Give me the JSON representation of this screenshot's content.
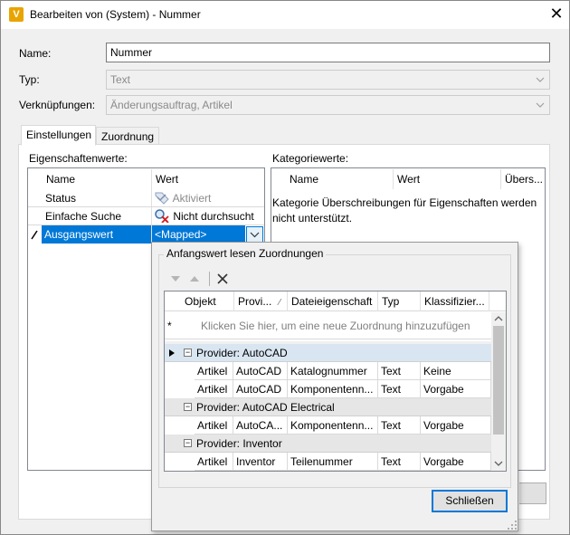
{
  "window": {
    "title": "Bearbeiten von (System) - Nummer",
    "app_icon_letter": "V"
  },
  "form": {
    "name_label": "Name:",
    "name_value": "Nummer",
    "type_label": "Typ:",
    "type_value": "Text",
    "links_label": "Verknüpfungen:",
    "links_value": "Änderungsauftrag, Artikel"
  },
  "tabs": [
    {
      "label": "Einstellungen"
    },
    {
      "label": "Zuordnung"
    }
  ],
  "properties": {
    "label": "Eigenschaftenwerte:",
    "columns": {
      "name": "Name",
      "value": "Wert"
    },
    "rows": [
      {
        "name": "Status",
        "value": "Aktiviert"
      },
      {
        "name": "Einfache Suche",
        "value": "Nicht durchsucht"
      },
      {
        "name": "Ausgangswert",
        "value": "<Mapped>"
      }
    ]
  },
  "categories": {
    "label": "Kategoriewerte:",
    "columns": {
      "name": "Name",
      "value": "Wert",
      "override": "Übers..."
    },
    "message": "Kategorie Überschreibungen für Eigenschaften werden nicht unterstützt."
  },
  "mapping": {
    "group_title": "Anfangswert lesen Zuordnungen",
    "columns": {
      "object": "Objekt",
      "provider": "Provi...",
      "file_property": "Dateieigenschaft",
      "type": "Typ",
      "classification": "Klassifizier..."
    },
    "new_row_hint": "Klicken Sie hier, um eine neue Zuordnung hinzuzufügen",
    "groups": [
      {
        "title": "Provider: AutoCAD",
        "rows": [
          {
            "object": "Artikel",
            "provider": "AutoCAD",
            "file_property": "Katalognummer",
            "type": "Text",
            "classification": "Keine"
          },
          {
            "object": "Artikel",
            "provider": "AutoCAD",
            "file_property": "Komponentenn...",
            "type": "Text",
            "classification": "Vorgabe"
          }
        ]
      },
      {
        "title": "Provider: AutoCAD Electrical",
        "rows": [
          {
            "object": "Artikel",
            "provider": "AutoCA...",
            "file_property": "Komponentenn...",
            "type": "Text",
            "classification": "Vorgabe"
          }
        ]
      },
      {
        "title": "Provider: Inventor",
        "rows": [
          {
            "object": "Artikel",
            "provider": "Inventor",
            "file_property": "Teilenummer",
            "type": "Text",
            "classification": "Vorgabe"
          }
        ]
      }
    ],
    "close_label": "Schließen"
  },
  "colors": {
    "selection": "#0078d7",
    "accent_icon": "#e8a400"
  },
  "icons": [
    "app-icon",
    "close-icon",
    "checkmark-tag-icon",
    "no-search-icon",
    "pencil-icon",
    "dropdown-arrow-icon",
    "move-down-icon",
    "move-up-icon",
    "delete-icon",
    "asterisk-icon",
    "expand-arrow-icon",
    "collapse-icon"
  ]
}
